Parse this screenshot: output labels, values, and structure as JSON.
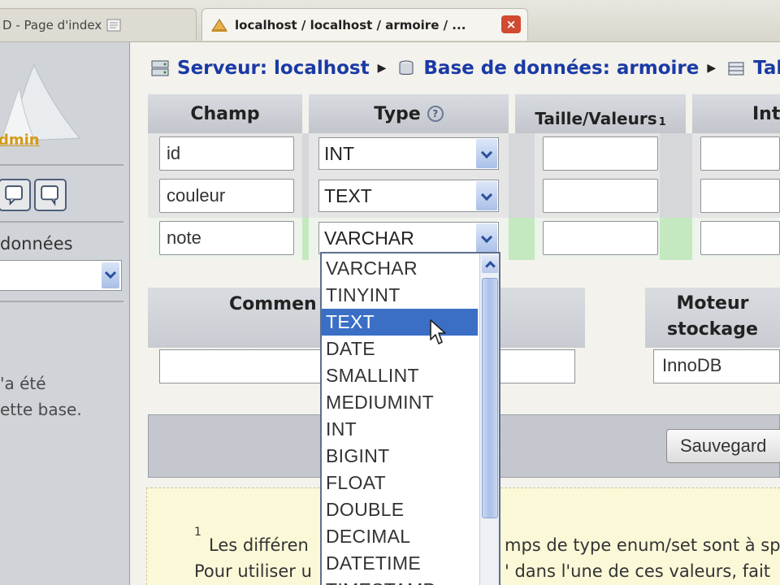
{
  "browser": {
    "tabs": [
      {
        "label": "D - Page d'index",
        "active": false
      },
      {
        "label": "localhost / localhost / armoire / ...",
        "active": true
      }
    ],
    "close_icon": "×"
  },
  "sidebar": {
    "logo_text": "dmin",
    "databases_label": "données",
    "database_select_value": "",
    "message_lines": [
      "'a été",
      "ette base."
    ]
  },
  "breadcrumb": {
    "server": "Serveur: localhost",
    "database": "Base de données: armoire",
    "table": "Tab"
  },
  "fields_table": {
    "headers": {
      "champ": "Champ",
      "type": "Type",
      "size": "Taille/Valeurs",
      "size_sup": "1",
      "next": "Inte"
    },
    "rows": [
      {
        "name": "id",
        "type": "INT",
        "size": ""
      },
      {
        "name": "couleur",
        "type": "TEXT",
        "size": ""
      },
      {
        "name": "note",
        "type": "VARCHAR",
        "size": ""
      }
    ]
  },
  "table_options": {
    "comments_label": "Commen",
    "comments_value": "",
    "engine_label_line1": "Moteur",
    "engine_label_line2": "stockage",
    "engine_value": "InnoDB"
  },
  "save_button": "Sauvegard",
  "footnote": {
    "marker": "1",
    "line1_left": "Les différen",
    "line1_right": "mps de type enum/set sont à sp",
    "line2_left": "Pour utiliser u",
    "line2_right": "' dans l'une de ces valeurs, fait"
  },
  "type_dropdown": {
    "selected": "TEXT",
    "options": [
      "VARCHAR",
      "TINYINT",
      "TEXT",
      "DATE",
      "SMALLINT",
      "MEDIUMINT",
      "INT",
      "BIGINT",
      "FLOAT",
      "DOUBLE",
      "DECIMAL",
      "DATETIME",
      "TIMESTAMP"
    ]
  },
  "colors": {
    "link": "#1a3aa6",
    "selection": "#3a6fc5",
    "editing_row": "#c4e8c0",
    "footnote_bg": "#fbf8d8"
  }
}
